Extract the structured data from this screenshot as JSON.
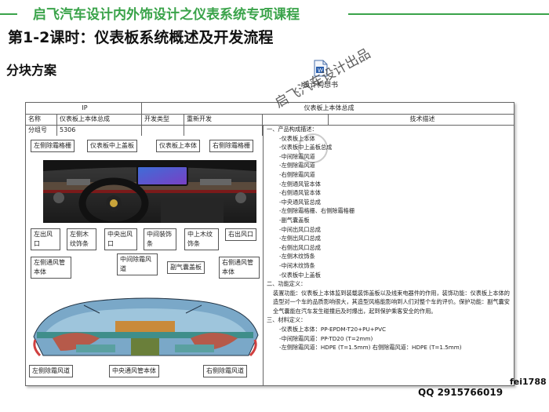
{
  "header": {
    "title": "启飞汽车设计内外饰设计之仪表系统专项课程",
    "lesson": "第1-2课时：仪表板系统概述及开发流程",
    "section": "分块方案"
  },
  "doc_icon": {
    "label": "设计构想书"
  },
  "table": {
    "row1": [
      "IP",
      "仪表板上本体总成"
    ],
    "row2": [
      "名称",
      "仪表板上本体总成",
      "开发类型",
      "重新开发",
      "",
      "技术描述"
    ],
    "row3": [
      "分组号",
      "5306"
    ]
  },
  "labels": {
    "top": [
      "左侧除霜格栅",
      "仪表板中上盖板",
      "仪表板上本体",
      "右侧除霜格栅"
    ],
    "mid": [
      "左出风口",
      "左侧木纹饰条",
      "中央出风口",
      "中间装饰条",
      "中上木纹饰条",
      "右出风口"
    ],
    "mid2": [
      "左侧通风管本体",
      "中间除霜风道",
      "副气囊盖板",
      "右侧通风管本体"
    ],
    "bottom": [
      "左侧除霜风道",
      "中央通风管本体",
      "右侧除霜风道"
    ]
  },
  "description": {
    "s1_title": "一、产品构成描述：",
    "s1_items": [
      "-仪表板上本体",
      "-仪表板中上盖板总成",
      "-中间除霜风道",
      "-左侧除霜风道",
      "-右侧除霜风道",
      "-左侧通风管本体",
      "-右侧通风管本体",
      "-中央通风管总成",
      "-左侧除霜格栅、右侧除霜格栅",
      "-副气囊盖板",
      "-中间出风口总成",
      "-左侧出风口总成",
      "-右侧出风口总成",
      "-左侧木纹饰条",
      "-中间木纹饰条",
      "-仪表板中上盖板"
    ],
    "s2_title": "二、功能定义：",
    "s2_text": "装置功能：仪表板上本体监到装载装饰盖板以及线束电器件的作用，装饰功能：仪表板上本体的造型对一个车的品质影响很大，其造型风格能影响到人们对整个车的评价。保护功能：副气囊安全气囊能在汽车发生碰撞后及时爆出，起到保护乘客安全的作用。",
    "s3_title": "三、材料定义：",
    "s3_items": [
      "-仪表板上本体：PP-EPDM-T20+PU+PVC",
      "-中间除霜风道：PP-TD20 (T=2mm)",
      "-左侧除霜风道：HDPE (T=1.5mm)  右侧除霜风道：HDPE (T=1.5mm)"
    ]
  },
  "watermark": "启飞汽车设计出品",
  "footer": {
    "id": "fei1788",
    "qq": "QQ 2915766019"
  }
}
